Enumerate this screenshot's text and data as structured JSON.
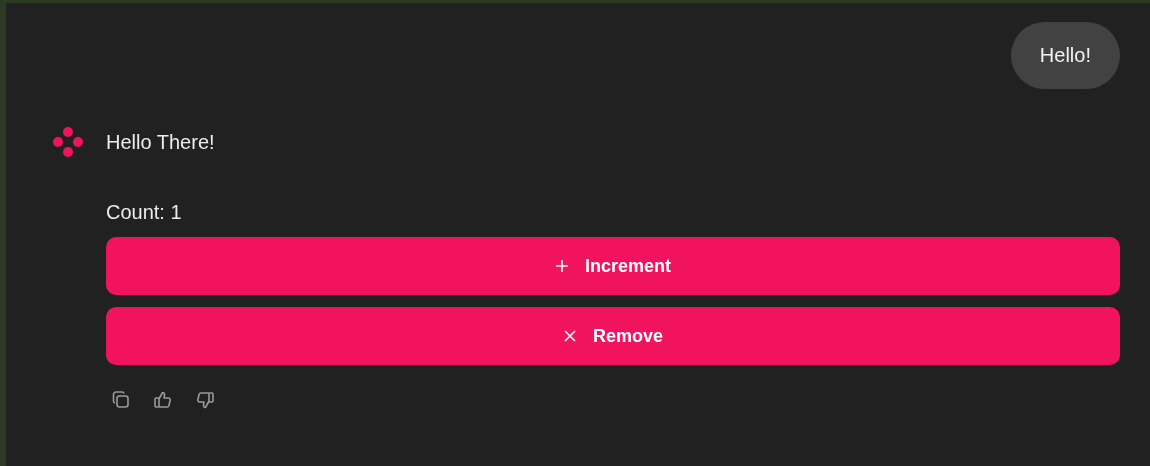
{
  "user_message": {
    "text": "Hello!"
  },
  "assistant_message": {
    "text": "Hello There!",
    "count_label": "Count: 1",
    "buttons": [
      {
        "kind": "plus",
        "label": "Increment"
      },
      {
        "kind": "close",
        "label": "Remove"
      }
    ],
    "actions": [
      {
        "kind": "copy"
      },
      {
        "kind": "thumbs-up"
      },
      {
        "kind": "thumbs-down"
      }
    ]
  }
}
